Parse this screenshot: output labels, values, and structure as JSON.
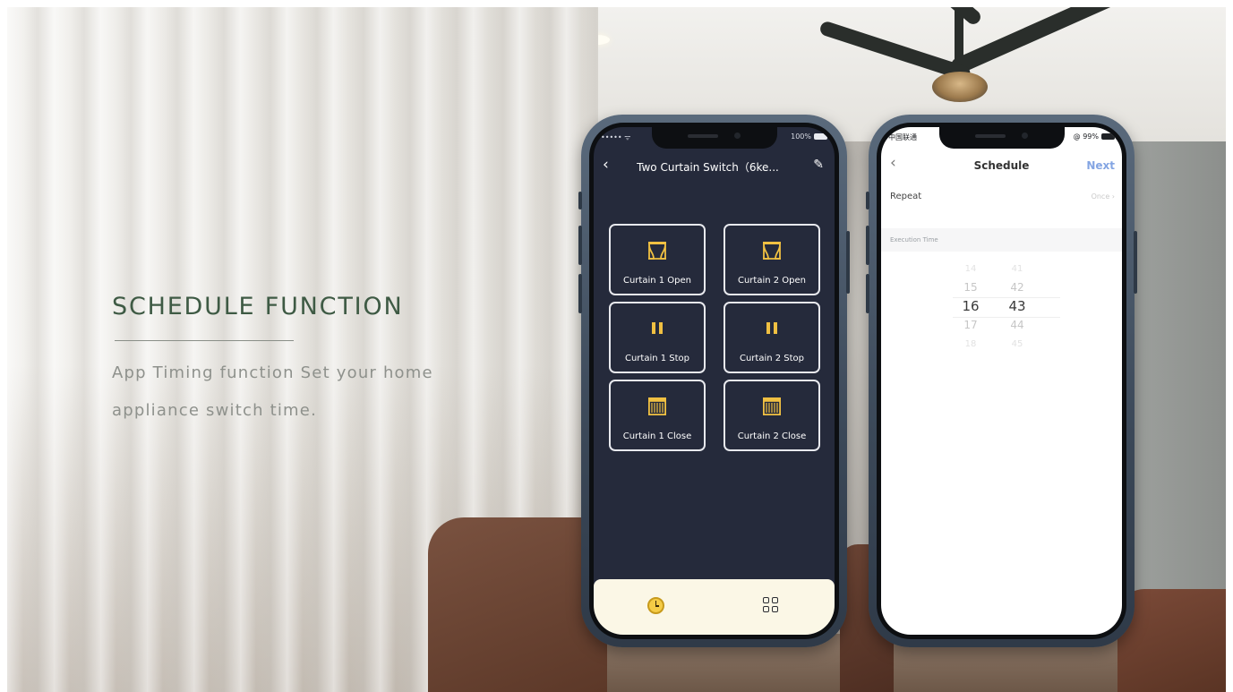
{
  "headline": "SCHEDULE FUNCTION",
  "subtext": "App Timing function Set your home appliance switch time.",
  "phone_left": {
    "status": {
      "carrier": "••••• ᯤ",
      "battery": "100%"
    },
    "nav": {
      "back": "‹",
      "title": "Two Curtain Switch（6ke...",
      "edit": "✎"
    },
    "buttons": [
      {
        "label": "Curtain 1 Open",
        "icon": "curtain-open-icon"
      },
      {
        "label": "Curtain 2 Open",
        "icon": "curtain-open-icon"
      },
      {
        "label": "Curtain 1 Stop",
        "icon": "pause-icon"
      },
      {
        "label": "Curtain 2 Stop",
        "icon": "pause-icon"
      },
      {
        "label": "Curtain 1 Close",
        "icon": "curtain-close-icon"
      },
      {
        "label": "Curtain 2 Close",
        "icon": "curtain-close-icon"
      }
    ],
    "tabs": [
      {
        "icon": "clock-icon"
      },
      {
        "icon": "grid-icon"
      }
    ],
    "colors": {
      "screen_bg": "#252a3b",
      "icon_gold": "#f0c042",
      "tabbar_bg": "#fbf7e6"
    }
  },
  "phone_right": {
    "status": {
      "carrier": "中国联通",
      "battery": "@ 99%"
    },
    "nav": {
      "back": "‹",
      "title": "Schedule",
      "next": "Next"
    },
    "repeat": {
      "label": "Repeat",
      "value": "Once ›"
    },
    "execution_time": {
      "label": "Execution Time",
      "hours": [
        "14",
        "15",
        "16",
        "17",
        "18"
      ],
      "minutes": [
        "41",
        "42",
        "43",
        "44",
        "45"
      ],
      "selected_hour": "16",
      "selected_minute": "43"
    },
    "colors": {
      "accent": "#84a5e3"
    }
  }
}
